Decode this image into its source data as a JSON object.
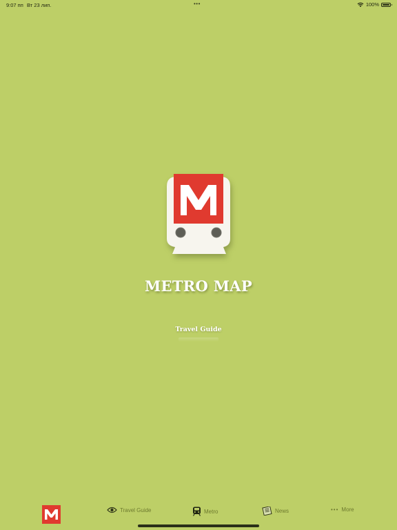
{
  "status_bar": {
    "time": "9:07 пп",
    "date": "Вт 23 лип.",
    "battery": "100%",
    "wifi_icon": "wifi-icon",
    "battery_icon": "battery-icon"
  },
  "splash": {
    "logo_letter": "M",
    "title": "METRO MAP",
    "subtitle": "Travel Guide"
  },
  "tab_bar": {
    "items": [
      {
        "label": "",
        "icon": "metro-logo-icon"
      },
      {
        "label": "Travel Guide",
        "icon": "eye-icon"
      },
      {
        "label": "Metro",
        "icon": "train-icon"
      },
      {
        "label": "News",
        "icon": "newspaper-icon"
      },
      {
        "label": "More",
        "icon": "more-dots-icon"
      }
    ]
  },
  "colors": {
    "background": "#bdcf67",
    "brand_red": "#e03a2f",
    "tab_text": "#6d7a2e",
    "white": "#ffffff"
  }
}
